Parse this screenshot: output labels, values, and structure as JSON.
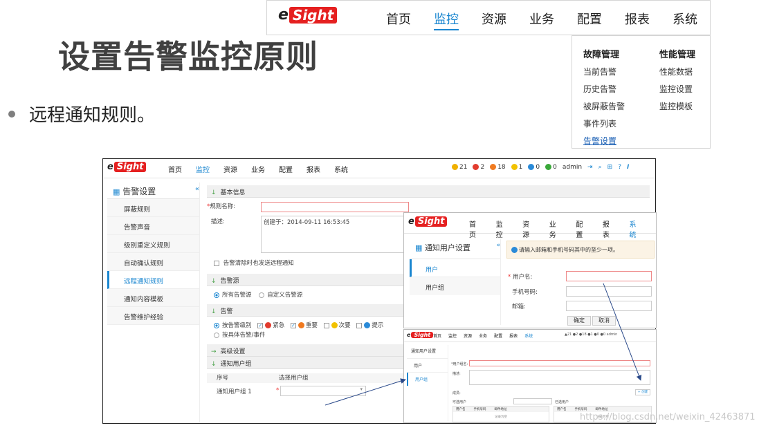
{
  "slide": {
    "title": "设置告警监控原则",
    "bullet": "远程通知规则。"
  },
  "logo": {
    "e": "e",
    "sight": "Sight"
  },
  "topnav": {
    "items": [
      "首页",
      "监控",
      "资源",
      "业务",
      "配置",
      "报表",
      "系统"
    ],
    "active_index": 1
  },
  "dropdown": {
    "col1": {
      "header": "故障管理",
      "items": [
        "当前告警",
        "历史告警",
        "被屏蔽告警",
        "事件列表",
        "告警设置"
      ]
    },
    "col2": {
      "header": "性能管理",
      "items": [
        "性能数据",
        "监控设置",
        "监控模板"
      ]
    }
  },
  "main": {
    "nav": [
      "首页",
      "监控",
      "资源",
      "业务",
      "配置",
      "报表",
      "系统"
    ],
    "status": {
      "c1": "21",
      "c2": "2",
      "c3": "18",
      "c4": "1",
      "c5": "0",
      "c6": "0",
      "user": "admin"
    },
    "sidebar": {
      "title": "告警设置",
      "items": [
        "屏蔽规则",
        "告警声音",
        "级别重定义规则",
        "自动确认规则",
        "远程通知规则",
        "通知内容模板",
        "告警维护经验"
      ],
      "active_index": 4
    },
    "form": {
      "sec_basic": "基本信息",
      "rule_name_label": "规则名称:",
      "desc_label": "描述:",
      "desc_value": "创建于：2014-09-11 16:53:45",
      "clear_notify": "告警清除时也发送远程通知",
      "sec_source": "告警源",
      "src_all": "所有告警源",
      "src_custom": "自定义告警源",
      "sec_alarm": "告警",
      "by_level": "按告警级别",
      "lv_critical": "紧急",
      "lv_major": "重要",
      "lv_minor": "次要",
      "lv_warning": "提示",
      "by_specific": "按具体告警/事件",
      "sec_advanced": "高级设置",
      "sec_notify_group": "通知用户组",
      "col_no": "序号",
      "col_select": "选择用户组",
      "row1": "通知用户组 1"
    }
  },
  "overlay1": {
    "nav": [
      "首页",
      "监控",
      "资源",
      "业务",
      "配置",
      "报表",
      "系统"
    ],
    "side_title": "通知用户设置",
    "side_items": [
      "用户",
      "用户组"
    ],
    "info": "请输入邮箱和手机号码其中的至少一项。",
    "username_label": "用户名:",
    "phone_label": "手机号码:",
    "email_label": "邮箱:",
    "ok": "确定",
    "cancel": "取消"
  },
  "overlay2": {
    "nav": [
      "首页",
      "监控",
      "资源",
      "业务",
      "配置",
      "报表",
      "系统"
    ],
    "status": "▲21 ●2 ●18 ●1 ●0 ●0 admin",
    "side_title": "通知用户设置",
    "side_items": [
      "用户",
      "用户组"
    ],
    "name_label": "*用户组名:",
    "desc_label": "描述:",
    "add_btn": "+ 创建",
    "member_label": "成员:",
    "search_label": "可选用户",
    "selected_label": "已选用户",
    "col_user": "用户名",
    "col_phone": "手机号码",
    "col_email": "邮件地址",
    "empty": "记录为空"
  },
  "watermark": "https://blog.csdn.net/weixin_42463871"
}
